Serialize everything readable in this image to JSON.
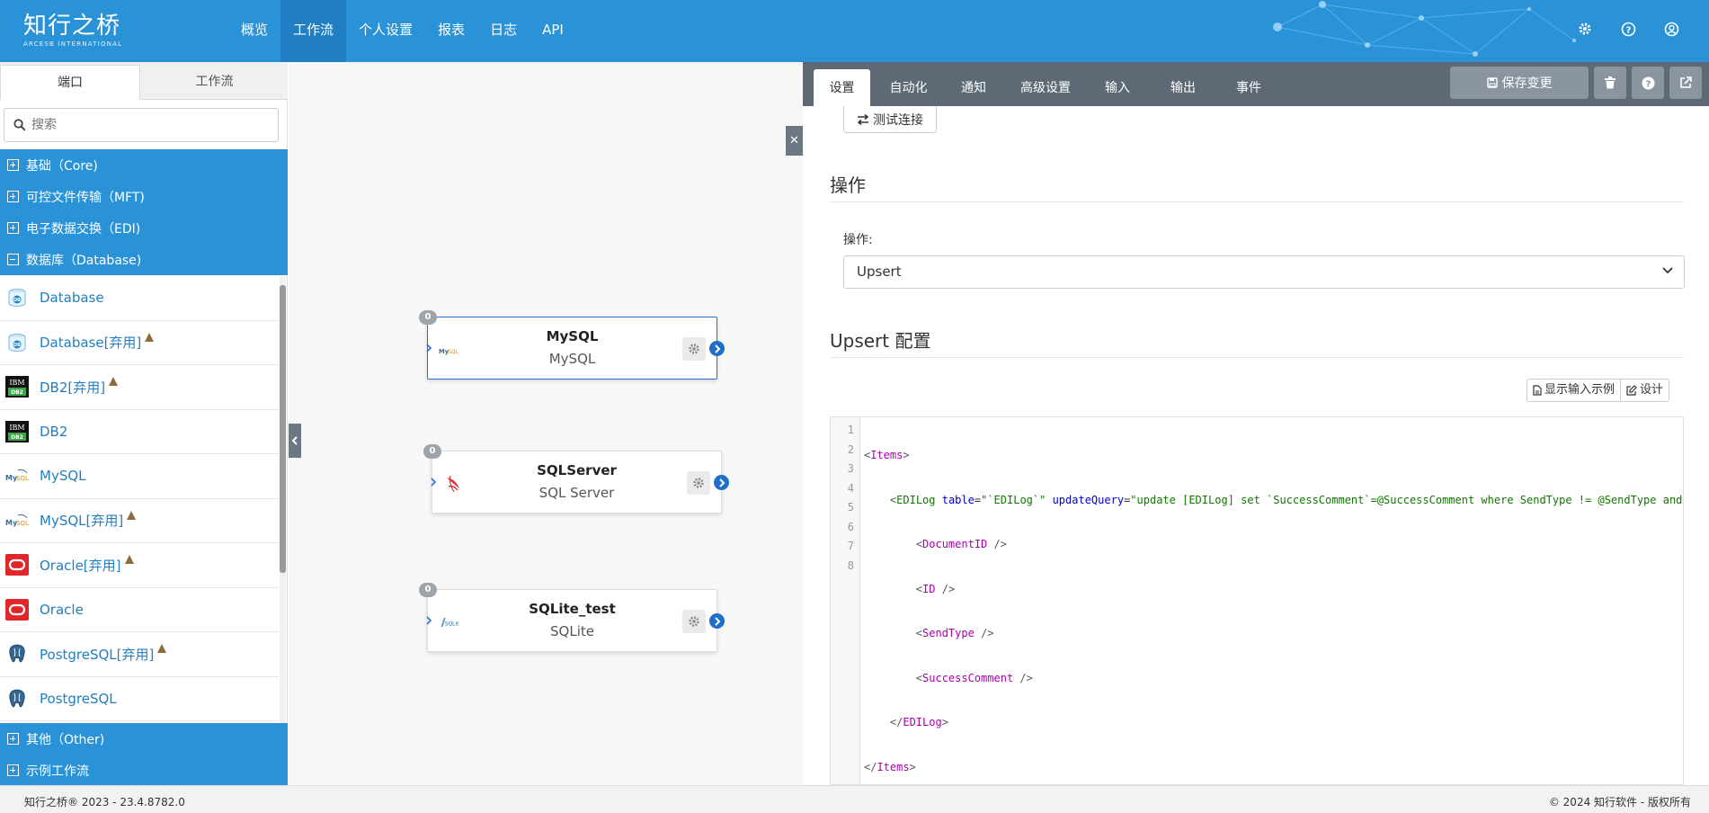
{
  "brand": {
    "name": "知行之桥",
    "tagline": "ARCESB INTERNATIONAL"
  },
  "nav": [
    {
      "label": "概览"
    },
    {
      "label": "工作流",
      "active": true
    },
    {
      "label": "个人设置"
    },
    {
      "label": "报表"
    },
    {
      "label": "日志"
    },
    {
      "label": "API"
    }
  ],
  "sidebar": {
    "tabs": [
      "端口",
      "工作流"
    ],
    "search_placeholder": "搜索",
    "categories": [
      "基础（Core)",
      "可控文件传输（MFT)",
      "电子数据交换（EDI)",
      "数据库（Database)",
      "其他（Other)",
      "示例工作流"
    ],
    "items": [
      {
        "label": "Database",
        "icon": "database-icon",
        "warn": false
      },
      {
        "label": "Database[弃用]",
        "icon": "database-icon",
        "warn": true
      },
      {
        "label": "DB2[弃用]",
        "icon": "ibm-db2-icon",
        "warn": true
      },
      {
        "label": "DB2",
        "icon": "ibm-db2-icon",
        "warn": false
      },
      {
        "label": "MySQL",
        "icon": "mysql-icon",
        "warn": false
      },
      {
        "label": "MySQL[弃用]",
        "icon": "mysql-icon",
        "warn": true
      },
      {
        "label": "Oracle[弃用]",
        "icon": "oracle-icon",
        "warn": true
      },
      {
        "label": "Oracle",
        "icon": "oracle-icon",
        "warn": false
      },
      {
        "label": "PostgreSQL[弃用]",
        "icon": "postgresql-icon",
        "warn": true
      },
      {
        "label": "PostgreSQL",
        "icon": "postgresql-icon",
        "warn": false
      }
    ]
  },
  "nodes": [
    {
      "badge": "0",
      "title": "MySQL",
      "sub": "MySQL",
      "icon": "mysql-icon"
    },
    {
      "badge": "0",
      "title": "SQLServer",
      "sub": "SQL Server",
      "icon": "sqlserver-icon"
    },
    {
      "badge": "0",
      "title": "SQLite_test",
      "sub": "SQLite",
      "icon": "sqlite-icon"
    }
  ],
  "panel": {
    "tabs": [
      "设置",
      "自动化",
      "通知",
      "高级设置",
      "输入",
      "输出",
      "事件"
    ],
    "save_label": "保存变更",
    "test_label": "测试连接",
    "section_operation": "操作",
    "operation_label": "操作:",
    "operation_value": "Upsert",
    "section_config": "Upsert 配置",
    "show_sample_label": "显示输入示例",
    "design_label": "设计",
    "code_lines": [
      "1",
      "2",
      "3",
      "4",
      "5",
      "6",
      "7",
      "8"
    ]
  },
  "footer": {
    "left": "知行之桥® 2023 - 23.4.8782.0",
    "right": "© 2024 知行软件 - 版权所有"
  },
  "colors": {
    "primary": "#2a93d8",
    "panel_bar": "#5d6974",
    "link": "#1f7fc2"
  }
}
